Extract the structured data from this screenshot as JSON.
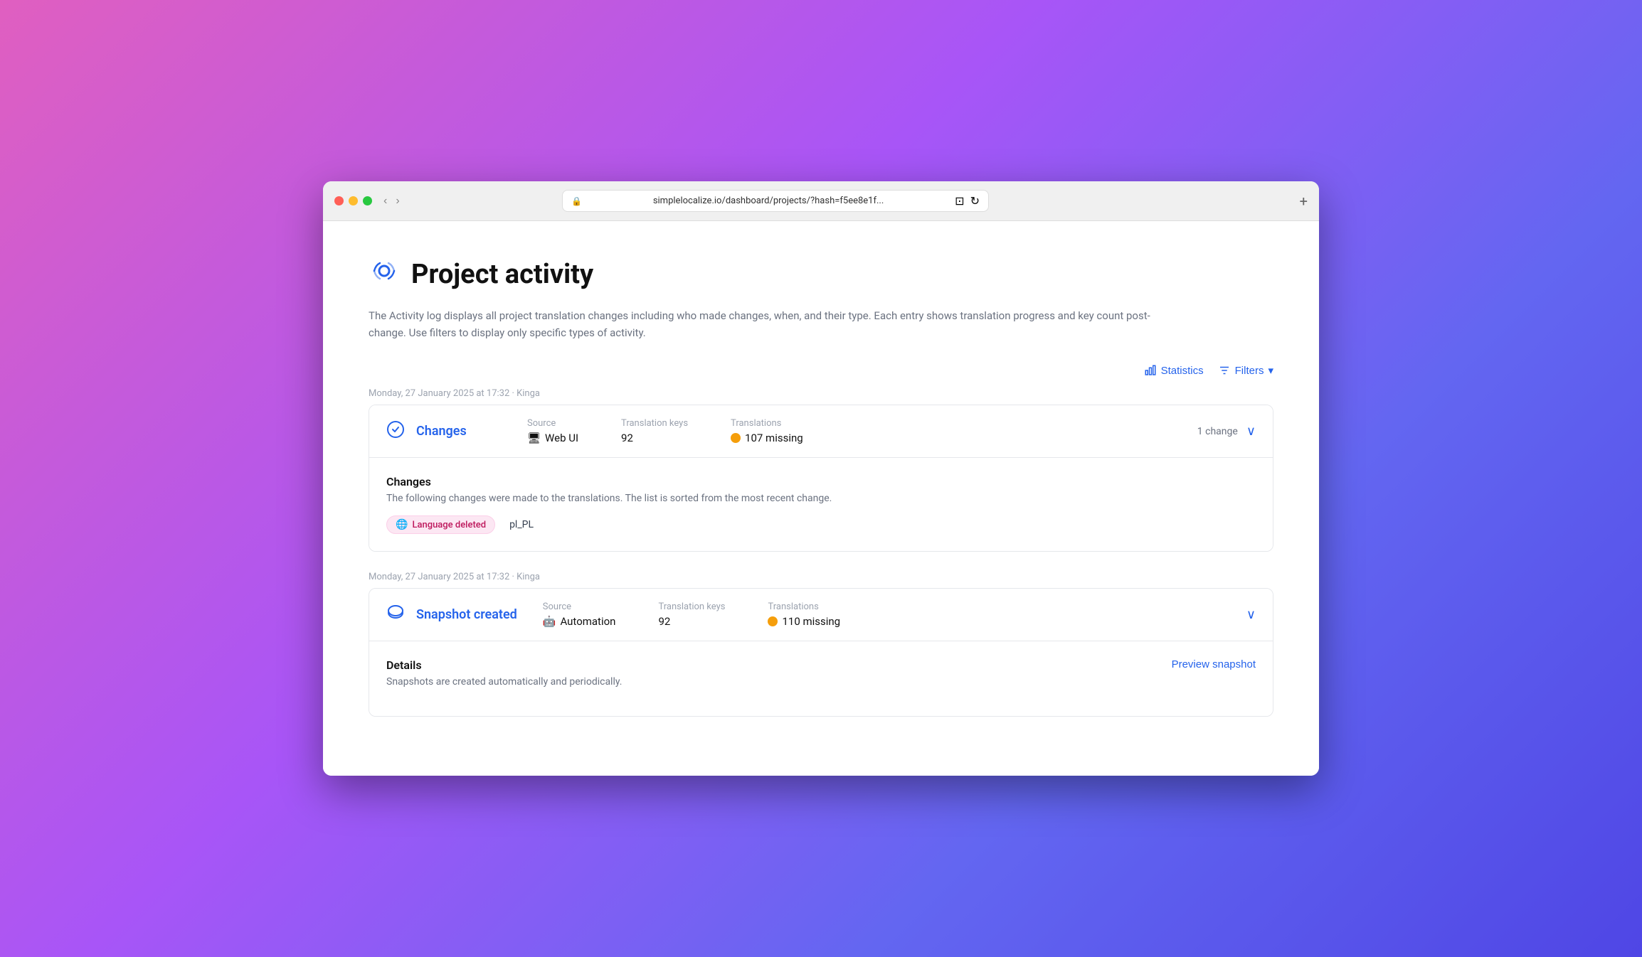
{
  "browser": {
    "url": "simplelocalize.io/dashboard/projects/?hash=f5ee8e1f...",
    "plus_label": "+"
  },
  "nav": {
    "back": "‹",
    "forward": "›"
  },
  "page": {
    "title": "Project activity",
    "description": "The Activity log displays all project translation changes including who made changes, when, and their type. Each entry shows translation progress and key count post-change. Use filters to display only specific types of activity."
  },
  "toolbar": {
    "statistics_label": "Statistics",
    "filters_label": "Filters"
  },
  "activity_groups": [
    {
      "meta": "Monday, 27 January 2025 at 17:32 · Kinga",
      "card": {
        "icon_type": "changes",
        "type_label": "Changes",
        "source_label": "Source",
        "source_icon": "🖥",
        "source_value": "Web UI",
        "keys_label": "Translation keys",
        "keys_value": "92",
        "translations_label": "Translations",
        "translations_status": "107 missing",
        "change_count": "1 change",
        "body": {
          "title": "Changes",
          "description": "The following changes were made to the translations. The list is sorted from the most recent change.",
          "change_tag": "Language deleted",
          "change_tag_value": "pl_PL"
        }
      }
    },
    {
      "meta": "Monday, 27 January 2025 at 17:32 · Kinga",
      "card": {
        "icon_type": "snapshot",
        "type_label": "Snapshot created",
        "source_label": "Source",
        "source_icon": "🤖",
        "source_value": "Automation",
        "keys_label": "Translation keys",
        "keys_value": "92",
        "translations_label": "Translations",
        "translations_status": "110 missing",
        "body": {
          "title": "Details",
          "description": "Snapshots are created automatically and periodically.",
          "preview_link": "Preview snapshot"
        }
      }
    }
  ]
}
